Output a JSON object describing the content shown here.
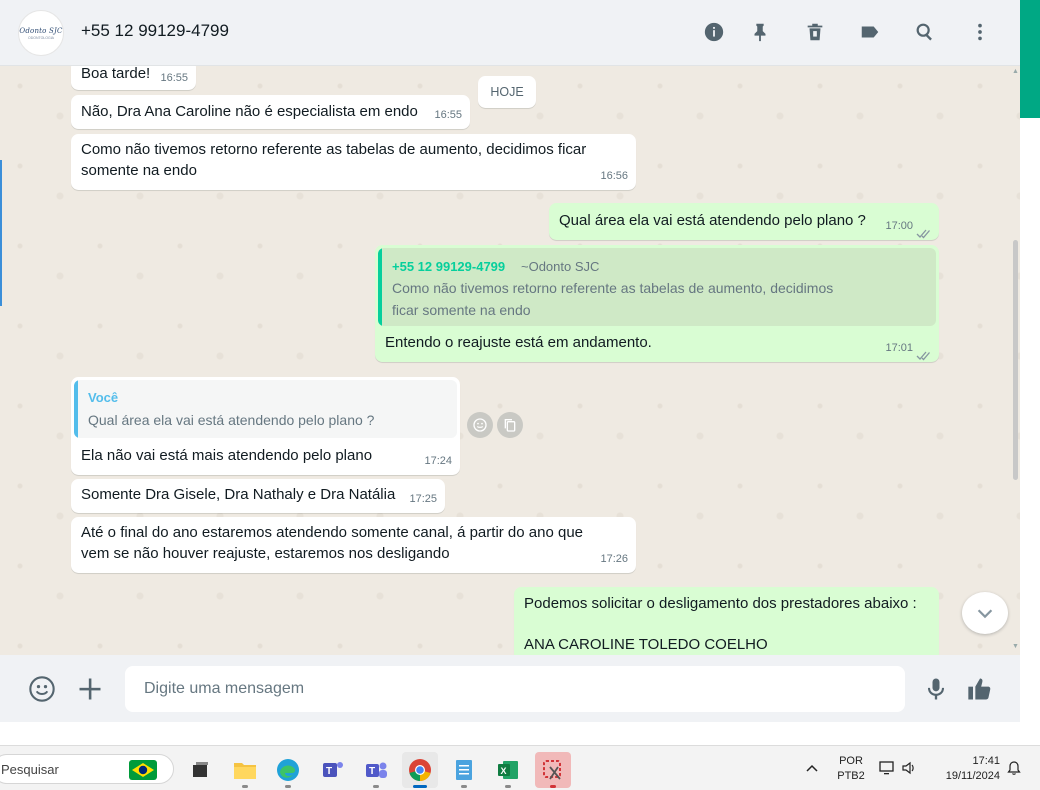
{
  "header": {
    "avatar_text": "Odonto SJC",
    "avatar_sub": "ODONTOLOGIA",
    "contact": "+55 12 99129-4799",
    "icons": [
      "info-icon",
      "pin-icon",
      "delete-icon",
      "label-icon",
      "search-icon",
      "menu-icon"
    ]
  },
  "date_chip": "HOJE",
  "messages": [
    {
      "dir": "in",
      "text": "Boa tarde!",
      "time": "16:55"
    },
    {
      "dir": "in",
      "text": "Não, Dra Ana Caroline não é especialista em endo",
      "time": "16:55"
    },
    {
      "dir": "in",
      "text_line1": "Como não tivemos retorno referente as tabelas de aumento, decidimos ficar",
      "text_line2": "somente na endo",
      "time": "16:56"
    },
    {
      "dir": "out",
      "text": "Qual área ela vai está atendendo pelo plano ?",
      "time": "17:00"
    },
    {
      "dir": "out",
      "quote_author": "+55 12 99129-4799",
      "quote_sub": "~Odonto SJC",
      "quote_line1": "Como não tivemos retorno referente as tabelas de aumento, decidimos",
      "quote_line2": "ficar somente na endo",
      "text": "Entendo o reajuste está em andamento.",
      "time": "17:01"
    },
    {
      "dir": "in",
      "quote_author": "Você",
      "quote_text": "Qual área ela vai está atendendo pelo plano ?",
      "text": "Ela não vai está mais atendendo pelo plano",
      "time": "17:24"
    },
    {
      "dir": "in",
      "text": "Somente Dra Gisele, Dra Nathaly e Dra Natália",
      "time": "17:25"
    },
    {
      "dir": "in",
      "text_line1": "Até o final do ano estaremos atendendo somente canal, á partir do ano que",
      "text_line2": "vem se não houver reajuste, estaremos nos desligando",
      "time": "17:26"
    },
    {
      "dir": "out",
      "text_line1": "Podemos solicitar o desligamento dos prestadores abaixo :",
      "text_line2": "ANA CAROLINE TOLEDO COELHO"
    }
  ],
  "footer": {
    "placeholder": "Digite uma mensagem"
  },
  "taskbar": {
    "search_text": "Pesquisar",
    "lang_line1": "POR",
    "lang_line2": "PTB2",
    "time": "17:41",
    "date": "19/11/2024"
  },
  "colors": {
    "accent": "#00a884",
    "incoming": "#ffffff",
    "outgoing": "#d9fdd3",
    "tick_read": "#53bdeb"
  }
}
